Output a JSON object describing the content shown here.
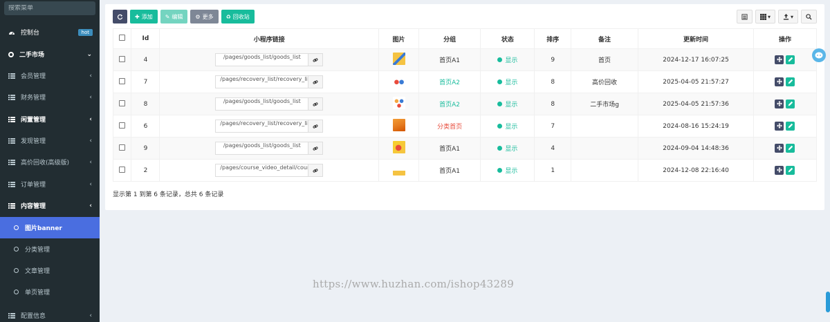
{
  "sidebar": {
    "search_placeholder": "搜索菜单",
    "dashboard": {
      "label": "控制台",
      "badge": "hot"
    },
    "second_hand": {
      "label": "二手市场"
    },
    "items": [
      {
        "label": "会员管理"
      },
      {
        "label": "财务管理"
      },
      {
        "label": "闲置管理"
      },
      {
        "label": "发现管理"
      },
      {
        "label": "高价回收(高级版)"
      },
      {
        "label": "订单管理"
      },
      {
        "label": "内容管理"
      }
    ],
    "sub_items": [
      {
        "label": "图片banner"
      },
      {
        "label": "分类管理"
      },
      {
        "label": "文章管理"
      },
      {
        "label": "单页管理"
      }
    ],
    "config": {
      "label": "配置信息"
    }
  },
  "toolbar": {
    "add_label": "添加",
    "edit_label": "编辑",
    "more_label": "更多",
    "recycle_label": "回收站"
  },
  "table": {
    "headers": {
      "id": "Id",
      "link": "小程序链接",
      "image": "图片",
      "group": "分组",
      "status": "状态",
      "sort": "排序",
      "note": "备注",
      "updated": "更新时间",
      "ops": "操作"
    },
    "rows": [
      {
        "id": "4",
        "link": "/pages/goods_list/goods_list",
        "group": "首页A1",
        "status": "显示",
        "sort": "9",
        "note": "首页",
        "updated": "2024-12-17 16:07:25"
      },
      {
        "id": "7",
        "link": "/pages/recovery_list/recovery_list",
        "group": "首页A2",
        "status": "显示",
        "sort": "8",
        "note": "高价回收",
        "updated": "2025-04-05 21:57:27"
      },
      {
        "id": "8",
        "link": "/pages/goods_list/goods_list",
        "group": "首页A2",
        "status": "显示",
        "sort": "8",
        "note": "二手市场g",
        "updated": "2025-04-05 21:57:36"
      },
      {
        "id": "6",
        "link": "/pages/recovery_list/recovery_list",
        "group": "分类首页",
        "status": "显示",
        "sort": "7",
        "note": "",
        "updated": "2024-08-16 15:24:19"
      },
      {
        "id": "9",
        "link": "/pages/goods_list/goods_list",
        "group": "首页A1",
        "status": "显示",
        "sort": "4",
        "note": "",
        "updated": "2024-09-04 14:48:36"
      },
      {
        "id": "2",
        "link": "/pages/course_video_detail/course_video",
        "group": "首页A1",
        "status": "显示",
        "sort": "1",
        "note": "",
        "updated": "2024-12-08 22:16:40"
      }
    ]
  },
  "summary": "显示第 1 到第 6 条记录，总共 6 条记录",
  "watermark": "https://www.huzhan.com/ishop43289",
  "colors": {
    "sidebar_bg": "#222d32",
    "active_nav": "#4a6ee0",
    "accent_green": "#18bc9c",
    "accent_red": "#e74c3c",
    "dark_button": "#444c69"
  }
}
